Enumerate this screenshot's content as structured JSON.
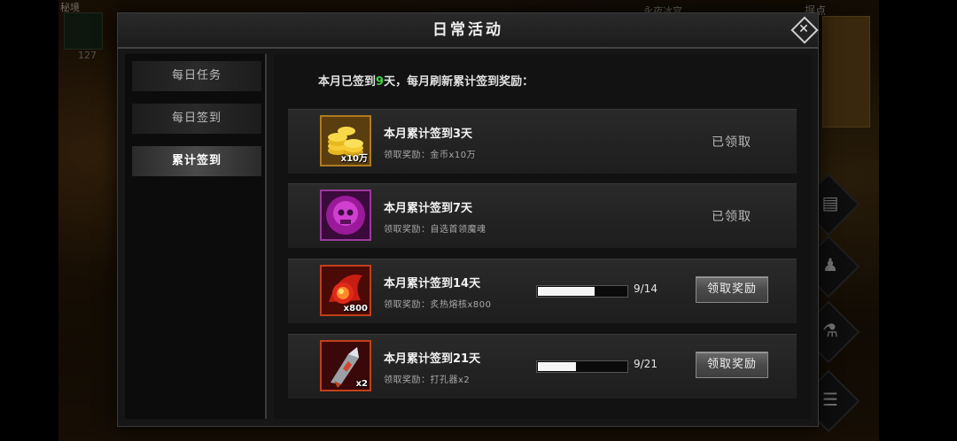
{
  "background": {
    "top_left_label": "秘境",
    "top_left_count": "127",
    "top_center_label": "永夜冰宫",
    "top_right_label": "据点"
  },
  "modal": {
    "title": "日常活动"
  },
  "sidebar": {
    "tabs": [
      {
        "label": "每日任务",
        "active": false
      },
      {
        "label": "每日签到",
        "active": false
      },
      {
        "label": "累计签到",
        "active": true
      }
    ]
  },
  "summary": {
    "prefix": "本月已签到",
    "days": "9",
    "suffix": "天，每月刷新累计签到奖励："
  },
  "rewards": [
    {
      "title": "本月累计签到3天",
      "desc": "领取奖励：金币x10万",
      "qty": "x10万",
      "icon": "gold-coins-icon",
      "status": "已领取"
    },
    {
      "title": "本月累计签到7天",
      "desc": "领取奖励：自选首领魔魂",
      "qty": "",
      "icon": "purple-skull-soul-icon",
      "status": "已领取"
    },
    {
      "title": "本月累计签到14天",
      "desc": "领取奖励：炙热熔核x800",
      "qty": "x800",
      "icon": "fire-core-icon",
      "progress_text": "9/14",
      "progress": 0.643,
      "button": "领取奖励"
    },
    {
      "title": "本月累计签到21天",
      "desc": "领取奖励：打孔器x2",
      "qty": "x2",
      "icon": "drill-blade-icon",
      "progress_text": "9/21",
      "progress": 0.429,
      "button": "领取奖励"
    }
  ]
}
